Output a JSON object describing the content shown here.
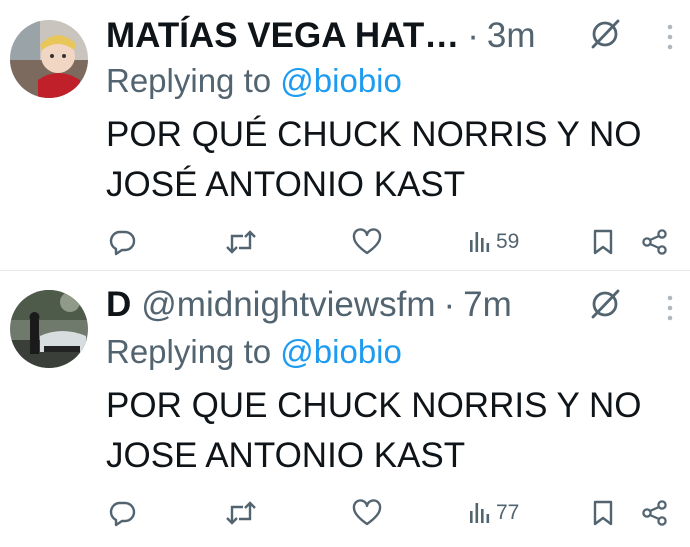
{
  "tweets": [
    {
      "name": "MATÍAS VEGA HAT…",
      "handle": "",
      "dot": "·",
      "time": "3m",
      "reply_prefix": "Replying to",
      "reply_mention": "@biobio",
      "text_lines": [
        "POR QUÉ CHUCK NORRIS Y NO",
        "JOSÉ ANTONIO KAST"
      ],
      "views": "59"
    },
    {
      "name": "D",
      "handle": "@midnightviewsfm",
      "dot": "·",
      "time": "7m",
      "reply_prefix": "Replying to",
      "reply_mention": "@biobio",
      "text_lines": [
        "POR QUE CHUCK NORRIS Y NO",
        "JOSE ANTONIO KAST"
      ],
      "views": "77"
    }
  ],
  "icons": {
    "reply": "reply-icon",
    "repost": "repost-icon",
    "like": "like-icon",
    "views": "views-icon",
    "bookmark": "bookmark-icon",
    "share": "share-icon",
    "grok": "grok-icon",
    "more": "more-icon"
  },
  "colors": {
    "text": "#0f1419",
    "secondary": "#536471",
    "link": "#1d9bf0",
    "divider": "#e6e9ec"
  }
}
